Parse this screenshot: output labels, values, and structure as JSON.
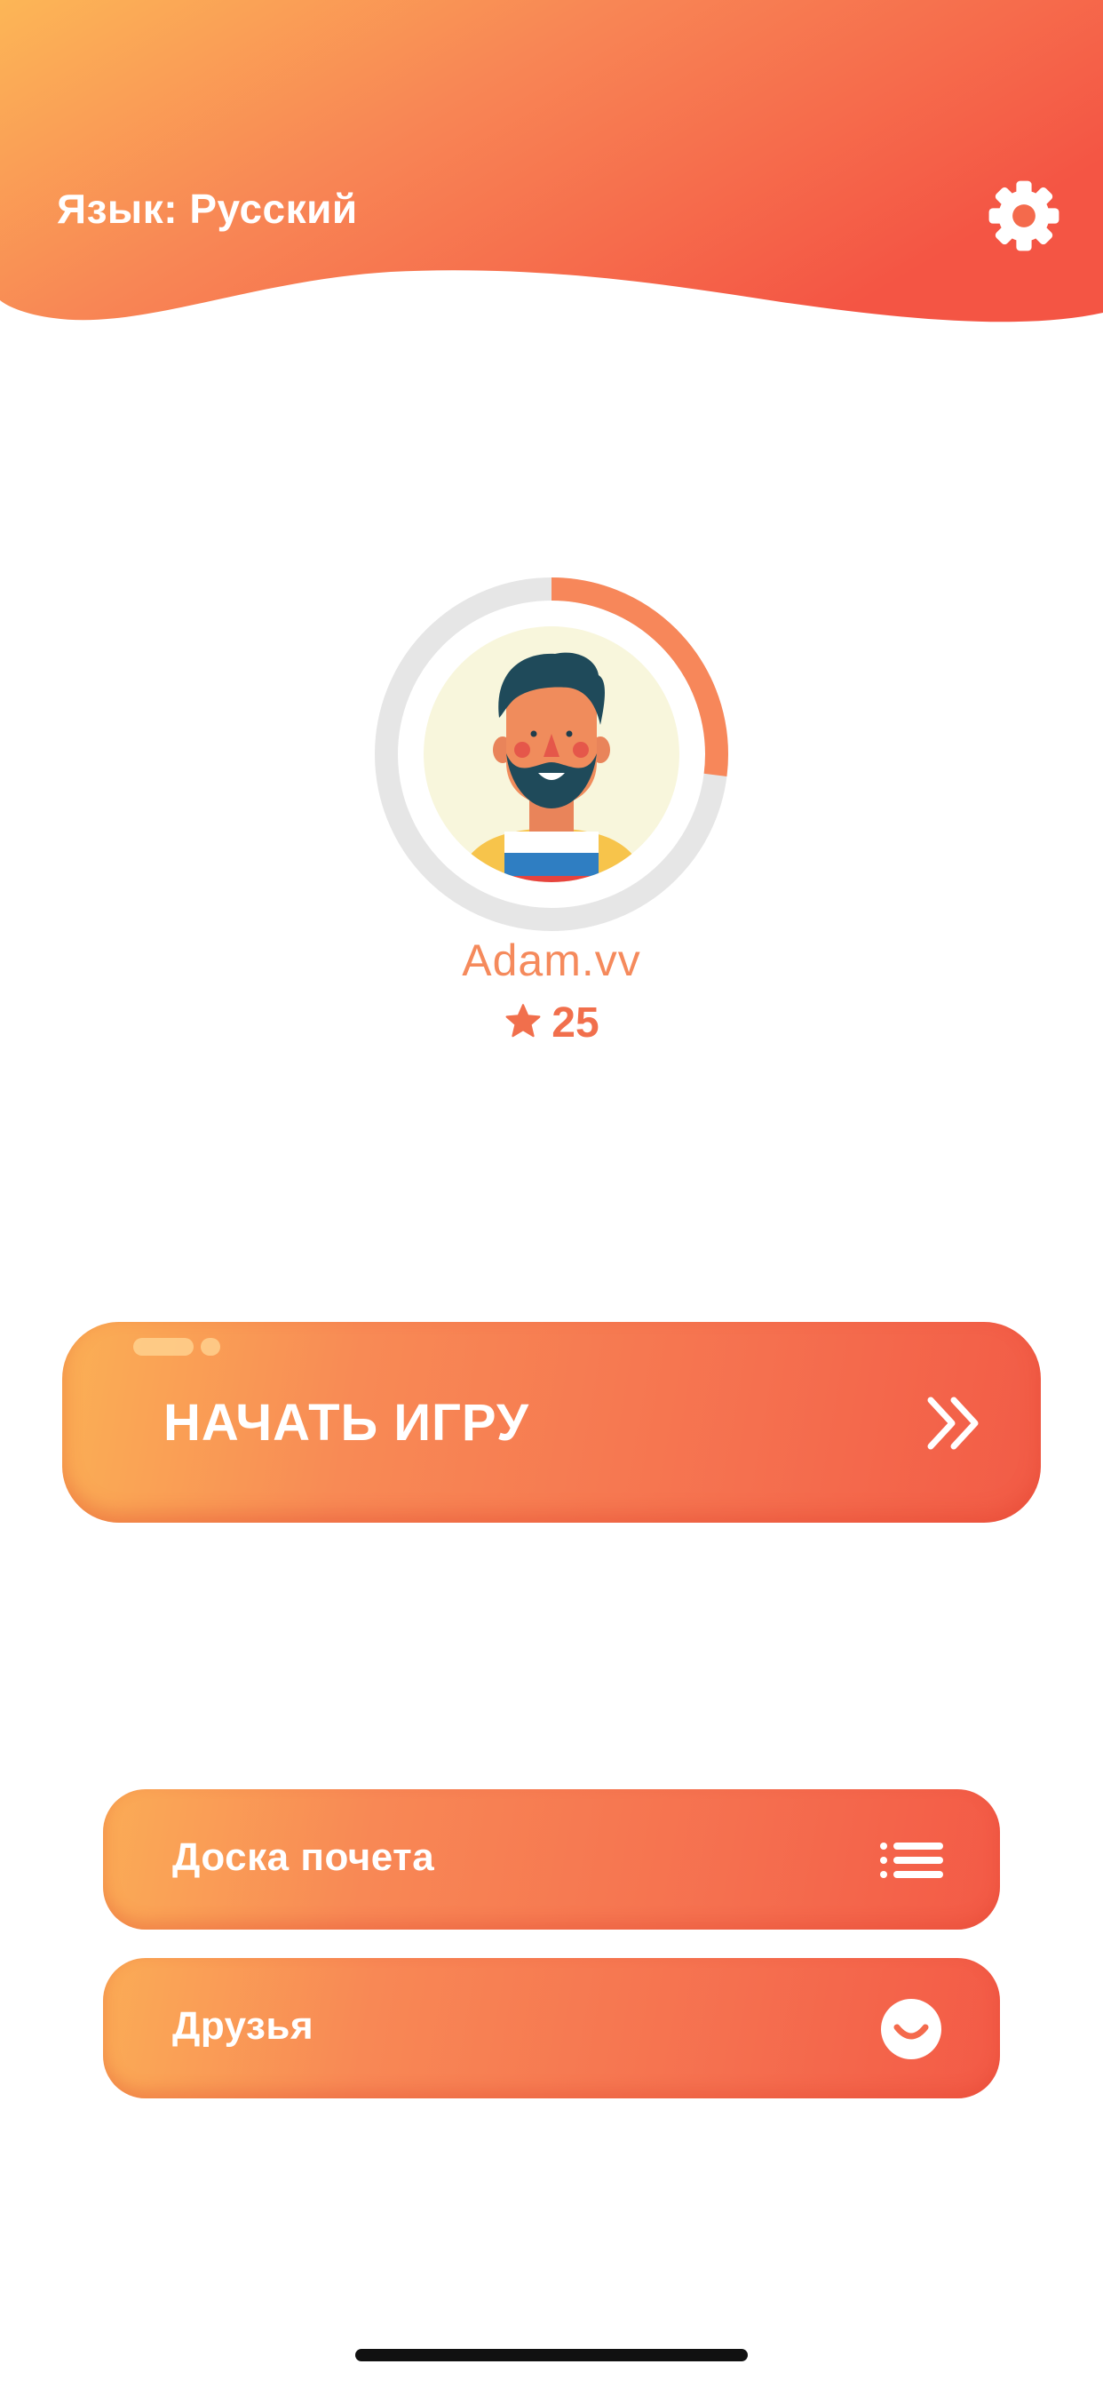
{
  "header": {
    "language_label": "Язык: Русский"
  },
  "profile": {
    "username": "Adam.vv",
    "score": "25",
    "level_progress": 0.27
  },
  "buttons": {
    "start_game": "НАЧАТЬ ИГРУ",
    "leaderboard": "Доска почета",
    "friends": "Друзья"
  },
  "icons": {
    "settings": "gear-icon",
    "star": "star-icon",
    "start_arrows": "double-chevron-right-icon",
    "leaderboard": "list-icon",
    "friends": "smile-icon"
  },
  "colors": {
    "accent_light": "#fbb055",
    "accent_mid": "#f5704f",
    "accent_dark": "#f25b46",
    "username": "#f58a5c",
    "avatar_bg": "#f8f6dc",
    "ring_track": "#e6e6e6"
  }
}
